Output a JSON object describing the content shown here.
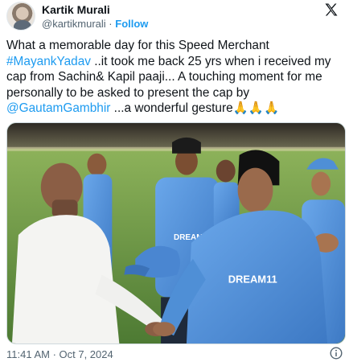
{
  "author": {
    "name": "Kartik Murali",
    "handle": "@kartikmurali",
    "separator": "·",
    "follow_label": "Follow"
  },
  "tweet": {
    "segments": [
      {
        "text": "What a memorable day for this Speed Merchant ",
        "type": "text"
      },
      {
        "text": "#MayankYadav",
        "type": "hashtag"
      },
      {
        "text": " ..it took me back 25 yrs when i received my cap from Sachin& Kapil paaji... A touching moment for me personally to be asked to present the cap by ",
        "type": "text"
      },
      {
        "text": "@GautamGambhir",
        "type": "mention"
      },
      {
        "text": " ...a wonderful gesture🙏🙏🙏",
        "type": "text"
      }
    ]
  },
  "media": {
    "jersey_text": "DREAM11",
    "jersey_text_main": "DREAM11"
  },
  "footer": {
    "timestamp": "11:41 AM · Oct 7, 2024"
  },
  "colors": {
    "link": "#1d9bf0",
    "text": "#0f1419",
    "muted": "#536471",
    "jersey": "#4f8fd6"
  },
  "icons": {
    "platform": "x-logo-icon",
    "info": "info-icon"
  }
}
